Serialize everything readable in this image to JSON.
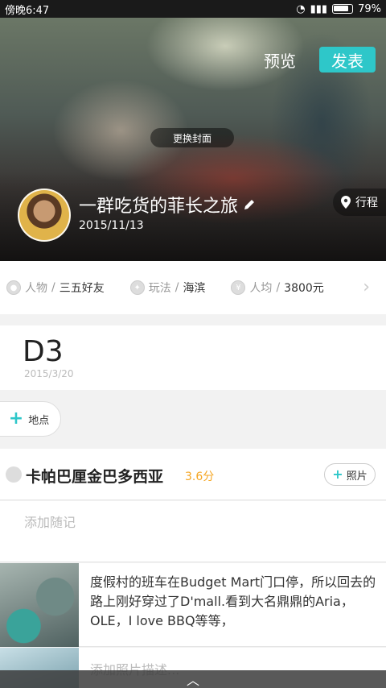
{
  "status_bar": {
    "time": "傍晚6:47",
    "battery": "79%"
  },
  "hero": {
    "preview_label": "预览",
    "publish_label": "发表",
    "change_cover_label": "更换封面",
    "trip_title": "一群吃货的菲长之旅",
    "trip_date": "2015/11/13",
    "itinerary_label": "行程"
  },
  "tags": [
    {
      "icon": "person-icon",
      "key": "人物",
      "value": "三五好友"
    },
    {
      "icon": "play-icon",
      "key": "玩法",
      "value": "海滨"
    },
    {
      "icon": "yen-icon",
      "key": "人均",
      "value": "3800元"
    }
  ],
  "day": {
    "label": "D3",
    "date": "2015/3/20"
  },
  "add_place_label": "地点",
  "place": {
    "name": "卡帕巴厘金巴多西亚",
    "rating": "3.6分",
    "photo_label": "照片"
  },
  "note_placeholder": "添加随记",
  "entry": {
    "text": "度假村的班车在Budget Mart门口停，所以回去的路上刚好穿过了D'mall.看到大名鼎鼎的Aria，OLE，I love BBQ等等，"
  },
  "entry2": {
    "placeholder": "添加照片描述..."
  },
  "colors": {
    "accent": "#2ec7c9",
    "rating": "#f5a623"
  }
}
